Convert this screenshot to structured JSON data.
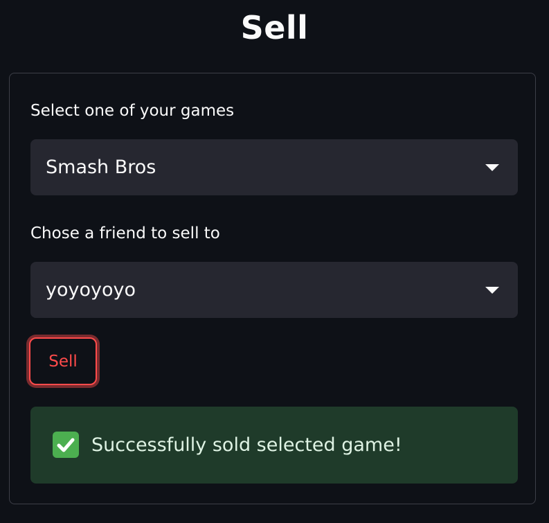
{
  "page": {
    "title": "Sell"
  },
  "form": {
    "game_select": {
      "label": "Select one of your games",
      "value": "Smash Bros"
    },
    "friend_select": {
      "label": "Chose a friend to sell to",
      "value": "yoyoyoyo"
    },
    "sell_button_label": "Sell",
    "success_message": "Successfully sold selected game!"
  },
  "icons": {
    "select_caret": "chevron-down-icon",
    "success": "check-icon"
  },
  "colors": {
    "background": "#0e1117",
    "accent": "#ff4b4b",
    "success_bg": "#1f3b2a",
    "select_bg": "#262730"
  }
}
